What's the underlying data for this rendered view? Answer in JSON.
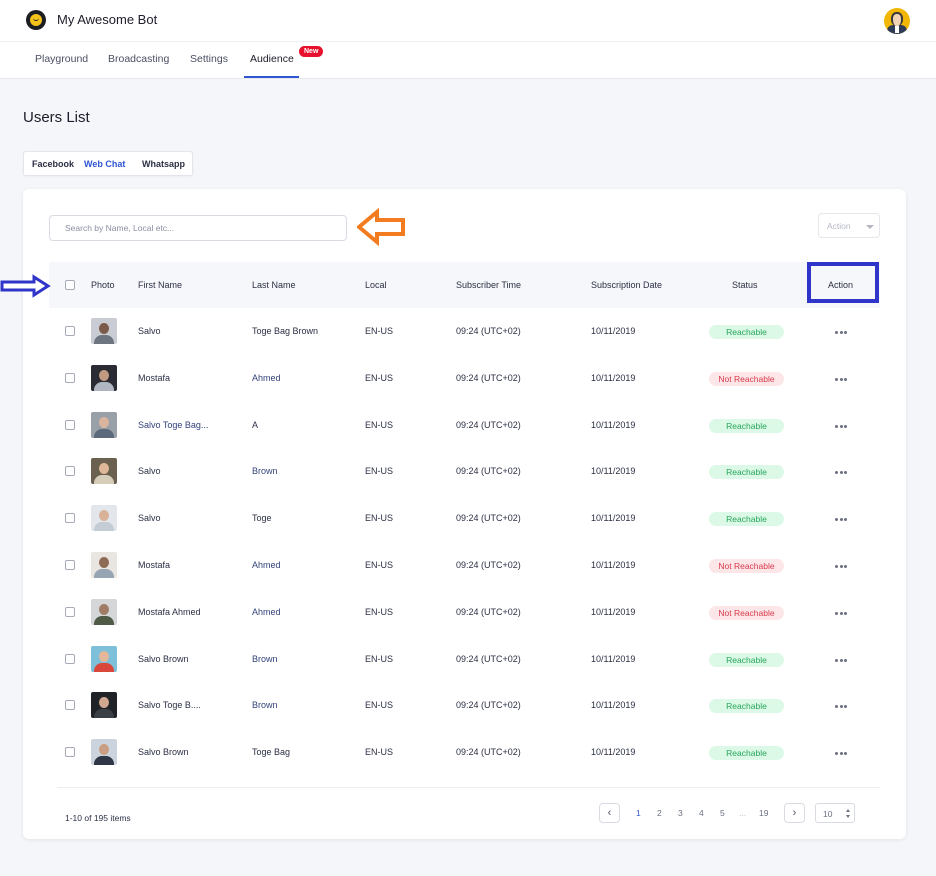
{
  "app": {
    "title": "My Awesome Bot",
    "logo_icon": "chat-bot-logo-icon",
    "user_avatar_icon": "user-avatar-icon"
  },
  "nav": {
    "tabs": [
      {
        "label": "Playground"
      },
      {
        "label": "Broadcasting"
      },
      {
        "label": "Settings"
      },
      {
        "label": "Audience",
        "active": true
      }
    ],
    "new_badge": "New"
  },
  "page": {
    "title": "Users List"
  },
  "channels": {
    "tabs": [
      {
        "label": "Facebook"
      },
      {
        "label": "Web Chat",
        "active": true
      },
      {
        "label": "Whatsapp"
      }
    ]
  },
  "search": {
    "placeholder": "Search by Name, Local etc..."
  },
  "bulk_action": {
    "label": "Action"
  },
  "annotations": {
    "orange_arrow_color": "#f47c20",
    "blue_arrow_color": "#2f35c9",
    "highlight_box_color": "#2f35c9"
  },
  "table": {
    "headers": {
      "photo": "Photo",
      "first_name": "First Name",
      "last_name": "Last Name",
      "local": "Local",
      "subscriber_time": "Subscriber Time",
      "subscription_date": "Subscription Date",
      "status": "Status",
      "action": "Action"
    },
    "rows": [
      {
        "first_name": "Salvo",
        "last_name": "Toge Bag Brown",
        "local": "EN-US",
        "time": "09:24 (UTC+02)",
        "date": "10/11/2019",
        "status": "Reachable",
        "reachable": true
      },
      {
        "first_name": "Mostafa",
        "last_name": "Ahmed",
        "local": "EN-US",
        "time": "09:24 (UTC+02)",
        "date": "10/11/2019",
        "status": "Not Reachable",
        "reachable": false
      },
      {
        "first_name": "Salvo Toge Bag...",
        "last_name": "A",
        "local": "EN-US",
        "time": "09:24 (UTC+02)",
        "date": "10/11/2019",
        "status": "Reachable",
        "reachable": true
      },
      {
        "first_name": "Salvo",
        "last_name": "Brown",
        "local": "EN-US",
        "time": "09:24 (UTC+02)",
        "date": "10/11/2019",
        "status": "Reachable",
        "reachable": true
      },
      {
        "first_name": "Salvo",
        "last_name": "Toge",
        "local": "EN-US",
        "time": "09:24 (UTC+02)",
        "date": "10/11/2019",
        "status": "Reachable",
        "reachable": true
      },
      {
        "first_name": "Mostafa",
        "last_name": "Ahmed",
        "local": "EN-US",
        "time": "09:24 (UTC+02)",
        "date": "10/11/2019",
        "status": "Not Reachable",
        "reachable": false
      },
      {
        "first_name": "Mostafa Ahmed",
        "last_name": "Ahmed",
        "local": "EN-US",
        "time": "09:24 (UTC+02)",
        "date": "10/11/2019",
        "status": "Not Reachable",
        "reachable": false
      },
      {
        "first_name": "Salvo Brown",
        "last_name": "Brown",
        "local": "EN-US",
        "time": "09:24 (UTC+02)",
        "date": "10/11/2019",
        "status": "Reachable",
        "reachable": true
      },
      {
        "first_name": "Salvo Toge B....",
        "last_name": "Brown",
        "local": "EN-US",
        "time": "09:24 (UTC+02)",
        "date": "10/11/2019",
        "status": "Reachable",
        "reachable": true
      },
      {
        "first_name": "Salvo  Brown",
        "last_name": "Toge Bag",
        "local": "EN-US",
        "time": "09:24 (UTC+02)",
        "date": "10/11/2019",
        "status": "Reachable",
        "reachable": true
      }
    ]
  },
  "pagination": {
    "summary": "1-10 of 195 items",
    "pages": [
      "1",
      "2",
      "3",
      "4",
      "5",
      "...",
      "19"
    ],
    "current": "1",
    "page_size": "10",
    "prev_icon": "chevron-left-icon",
    "next_icon": "chevron-right-icon"
  }
}
